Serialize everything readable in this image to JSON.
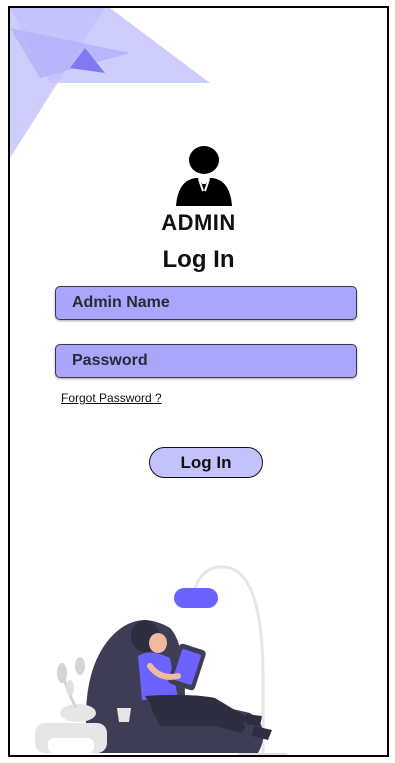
{
  "header": {
    "role_title": "ADMIN",
    "page_heading": "Log In"
  },
  "form": {
    "name_placeholder": "Admin Name",
    "password_placeholder": "Password",
    "forgot_password": "Forgot Password ?",
    "login_button": "Log In"
  },
  "icons": {
    "avatar": "admin-user-icon",
    "illustration": "person-reading-illustration"
  },
  "colors": {
    "accent": "#a9a6fb",
    "button": "#c4c2fb",
    "triangle": "#9b97f8",
    "figure_dark": "#3f3d56"
  }
}
